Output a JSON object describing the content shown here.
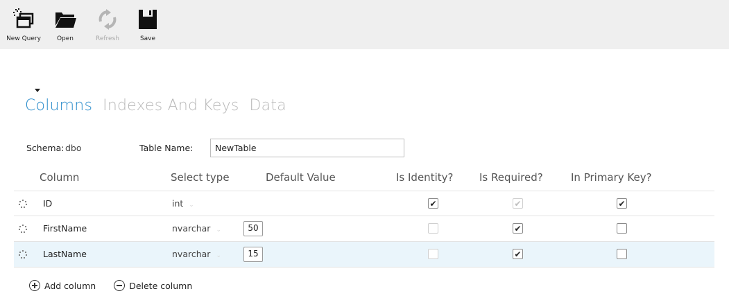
{
  "toolbar": {
    "new_query": "New Query",
    "open": "Open",
    "refresh": "Refresh",
    "save": "Save"
  },
  "tabs": {
    "columns": "Columns",
    "indexes": "Indexes And Keys",
    "data": "Data"
  },
  "schema": {
    "label": "Schema:",
    "value": "dbo"
  },
  "table_name": {
    "label": "Table Name:",
    "value": "NewTable"
  },
  "grid": {
    "headers": {
      "column": "Column",
      "type": "Select type",
      "default": "Default Value",
      "identity": "Is Identity?",
      "required": "Is Required?",
      "primary": "In Primary Key?"
    },
    "rows": [
      {
        "name": "ID",
        "type": "int",
        "length": "",
        "is_identity": true,
        "is_required": true,
        "is_required_disabled": true,
        "in_primary_key": true
      },
      {
        "name": "FirstName",
        "type": "nvarchar",
        "length": "50",
        "is_identity": false,
        "is_required": true,
        "in_primary_key": false
      },
      {
        "name": "LastName",
        "type": "nvarchar",
        "length": "15",
        "is_identity": false,
        "is_required": true,
        "in_primary_key": false
      }
    ]
  },
  "actions": {
    "add": "Add column",
    "delete": "Delete column"
  },
  "colors": {
    "accent": "#2a8ccb",
    "toolbar_bg": "#efefef",
    "selected_row": "#eaf5fb"
  },
  "icons": {
    "new_query": "new-query-icon",
    "open": "folder-icon",
    "refresh": "refresh-icon",
    "save": "floppy-disk-icon",
    "drag": "drag-handle-icon",
    "add": "plus-circle-icon",
    "delete": "minus-circle-icon"
  }
}
